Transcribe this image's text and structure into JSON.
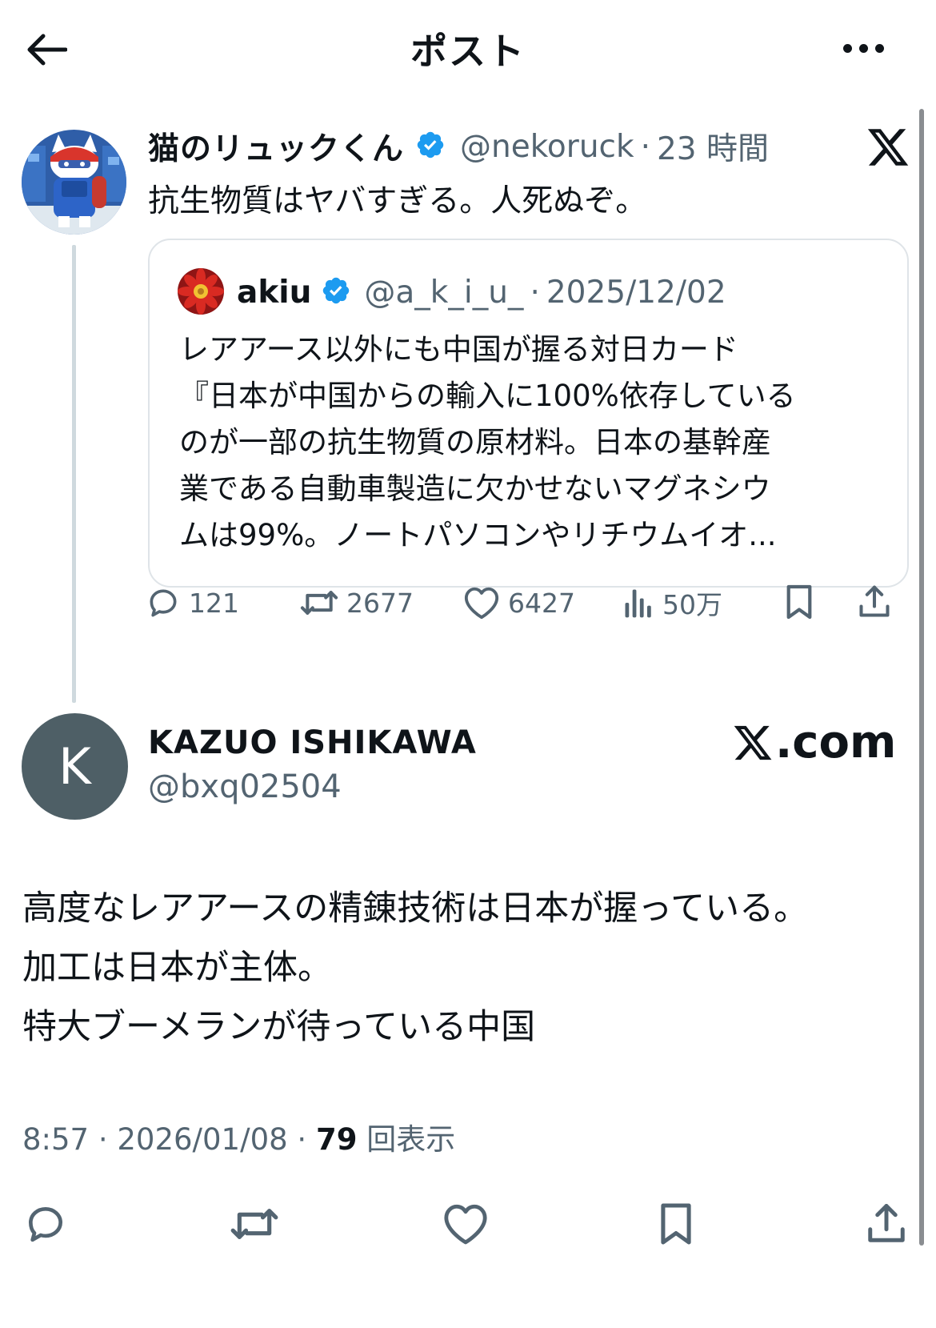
{
  "header": {
    "title": "ポスト"
  },
  "tweet": {
    "author_name": "猫のリュックくん",
    "handle": "@nekoruck",
    "separator": "·",
    "time": "23 時間",
    "text": "抗生物質はヤバすぎる。人死ぬぞ。",
    "quote": {
      "author_name": "akiu",
      "handle": "@a_k_i_u_",
      "separator": "·",
      "date": "2025/12/02",
      "lines": [
        "レアアース以外にも中国が握る対日カード",
        "『日本が中国からの輸入に100%依存している",
        "のが一部の抗生物質の原材料。日本の基幹産",
        "業である自動車製造に欠かせないマグネシウ",
        "ムは99%。ノートパソコンやリチウムイオ..."
      ]
    },
    "stats": {
      "replies": "121",
      "reposts": "2677",
      "likes": "6427",
      "views": "50万"
    }
  },
  "reply": {
    "avatar_letter": "K",
    "author_name": "KAZUO ISHIKAWA",
    "handle": "@bxq02504",
    "watermark": ".com",
    "lines": [
      "高度なレアアースの精錬技術は日本が握っている。",
      "加工は日本が主体。",
      "特大ブーメランが待っている中国"
    ],
    "meta": {
      "time": "8:57",
      "separator": "·",
      "date": "2026/01/08",
      "views_count": "79",
      "views_label": "回表示"
    }
  },
  "colors": {
    "text_primary": "#0f1419",
    "text_secondary": "#536471",
    "verified_blue": "#1d9bf0",
    "thread_line": "#cfd9de",
    "card_border": "#dfe4e8",
    "avatar_bg": "#4e5f66"
  },
  "icons": {
    "back": "arrow-left-icon",
    "more": "more-dots-icon",
    "verified": "verified-badge-icon",
    "x_logo": "x-logo-icon",
    "reply": "reply-bubble-icon",
    "repost": "repost-icon",
    "like": "heart-icon",
    "views": "bar-chart-icon",
    "bookmark": "bookmark-icon",
    "share": "share-icon"
  }
}
